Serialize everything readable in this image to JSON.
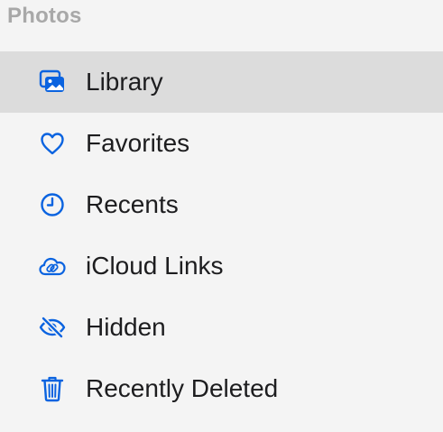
{
  "sidebar": {
    "section_title": "Photos",
    "accent_color": "#0a63e0",
    "selected_bg": "#dcdcdc",
    "items": [
      {
        "label": "Library",
        "icon": "photo-library-icon",
        "selected": true
      },
      {
        "label": "Favorites",
        "icon": "heart-icon",
        "selected": false
      },
      {
        "label": "Recents",
        "icon": "clock-icon",
        "selected": false
      },
      {
        "label": "iCloud Links",
        "icon": "cloud-link-icon",
        "selected": false
      },
      {
        "label": "Hidden",
        "icon": "eye-slash-icon",
        "selected": false
      },
      {
        "label": "Recently Deleted",
        "icon": "trash-icon",
        "selected": false
      }
    ]
  }
}
